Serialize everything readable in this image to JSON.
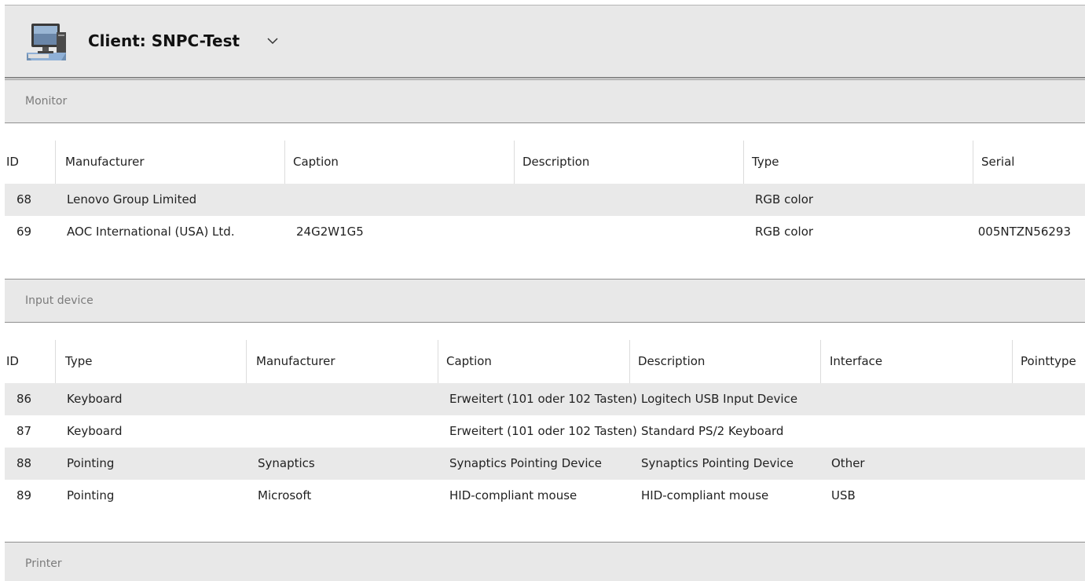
{
  "client": {
    "title": "Client: SNPC-Test"
  },
  "sections": {
    "monitor": {
      "label": "Monitor",
      "columns": [
        "ID",
        "Manufacturer",
        "Caption",
        "Description",
        "Type",
        "Serial"
      ],
      "rows": [
        [
          "68",
          "Lenovo Group Limited",
          "",
          "",
          "RGB color",
          ""
        ],
        [
          "69",
          "AOC International (USA) Ltd.",
          "24G2W1G5",
          "",
          "RGB color",
          "005NTZN56293"
        ]
      ]
    },
    "input": {
      "label": "Input device",
      "columns": [
        "ID",
        "Type",
        "Manufacturer",
        "Caption",
        "Description",
        "Interface",
        "Pointtype"
      ],
      "rows": [
        [
          "86",
          "Keyboard",
          "",
          "Erweitert (101 oder 102 Tasten)",
          "Logitech USB Input Device",
          "",
          ""
        ],
        [
          "87",
          "Keyboard",
          "",
          "Erweitert (101 oder 102 Tasten)",
          "Standard PS/2 Keyboard",
          "",
          ""
        ],
        [
          "88",
          "Pointing",
          "Synaptics",
          "Synaptics Pointing Device",
          "Synaptics Pointing Device",
          "Other",
          ""
        ],
        [
          "89",
          "Pointing",
          "Microsoft",
          "HID-compliant mouse",
          "HID-compliant mouse",
          "USB",
          ""
        ]
      ]
    },
    "printer": {
      "label": "Printer"
    }
  }
}
